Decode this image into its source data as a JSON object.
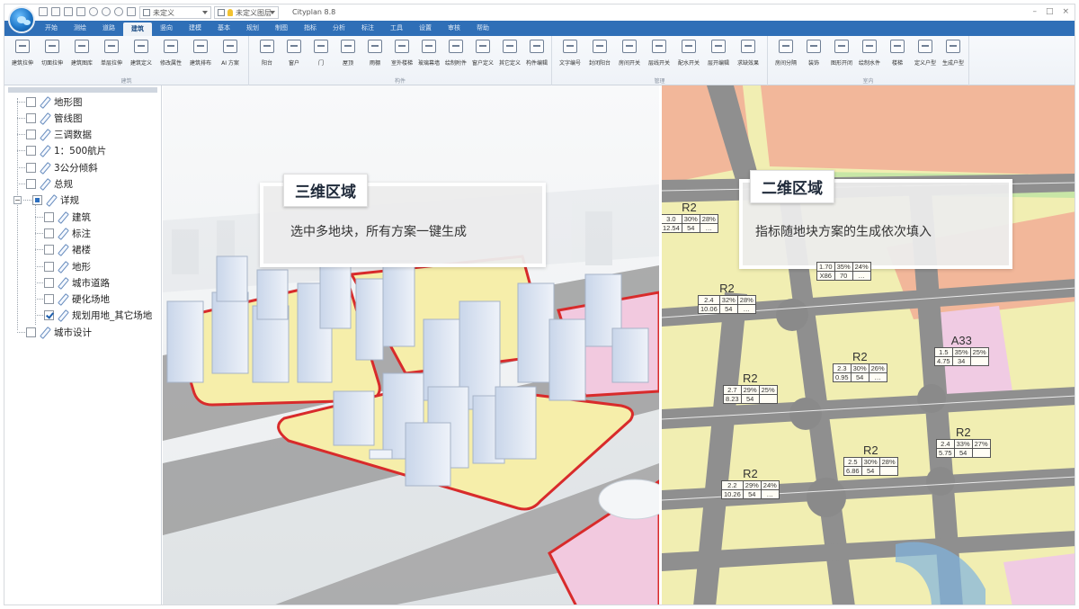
{
  "window": {
    "title": "Cityplan 8.8",
    "controls": [
      "–",
      "□",
      "×"
    ]
  },
  "quick_access": {
    "combo1": "未定义",
    "combo2": "未定义图层"
  },
  "ribbon": {
    "tabs": [
      "开始",
      "测绘",
      "道路",
      "建筑",
      "竖向",
      "建模",
      "基本",
      "规划",
      "制图",
      "指标",
      "分析",
      "标注",
      "工具",
      "设置",
      "审核",
      "帮助"
    ],
    "active_tab": "建筑",
    "groups": [
      {
        "title": "建筑",
        "buttons": [
          "建筑拉伸",
          "切面拉伸",
          "建筑图库",
          "单层拉伸",
          "建筑定义",
          "修改属性",
          "建筑排布",
          "AI 方案"
        ]
      },
      {
        "title": "构件",
        "buttons": [
          "阳台",
          "窗户",
          "门",
          "屋顶",
          "雨棚",
          "室外楼梯",
          "玻璃幕墙",
          "绘制附件",
          "窗户定义",
          "其它定义",
          "构件编辑"
        ]
      },
      {
        "title": "管理",
        "buttons": [
          "文字编号",
          "封闭阳台",
          "房间开关",
          "层线开关",
          "配水开关",
          "层开编辑",
          "求缺效果"
        ]
      },
      {
        "title": "室内",
        "buttons": [
          "房间分隔",
          "装饰",
          "图形开闭",
          "绘制水件",
          "楼梯",
          "定义户型",
          "生成户型"
        ]
      }
    ]
  },
  "tree": {
    "items": [
      {
        "label": "地形图",
        "state": "unchecked"
      },
      {
        "label": "管线图",
        "state": "unchecked"
      },
      {
        "label": "三调数据",
        "state": "unchecked"
      },
      {
        "label": "1：500航片",
        "state": "unchecked"
      },
      {
        "label": "3公分倾斜",
        "state": "unchecked"
      },
      {
        "label": "总规",
        "state": "unchecked"
      },
      {
        "label": "详规",
        "state": "partial"
      },
      {
        "label": "建筑",
        "state": "unchecked"
      },
      {
        "label": "标注",
        "state": "unchecked"
      },
      {
        "label": "裙楼",
        "state": "unchecked"
      },
      {
        "label": "地形",
        "state": "unchecked"
      },
      {
        "label": "城市道路",
        "state": "unchecked"
      },
      {
        "label": "硬化场地",
        "state": "unchecked"
      },
      {
        "label": "规划用地_其它场地",
        "state": "checked"
      },
      {
        "label": "城市设计",
        "state": "unchecked"
      }
    ]
  },
  "view3d": {
    "tag": "三维区域",
    "text": "选中多地块，所有方案一键生成"
  },
  "view2d": {
    "tag": "二维区域",
    "text": "指标随地块方案的生成依次填入",
    "parcels": [
      {
        "code": "R2",
        "far": "3.0",
        "density": "30%",
        "green": "28%",
        "height": "12.54",
        "floors": "54",
        "extra": "…"
      },
      {
        "code": "",
        "far": "1.70",
        "density": "35%",
        "green": "24%",
        "height": "X86",
        "floors": "70",
        "extra": "…"
      },
      {
        "code": "R2",
        "far": "2.4",
        "density": "32%",
        "green": "28%",
        "height": "10.06",
        "floors": "54",
        "extra": "…"
      },
      {
        "code": "A33",
        "far": "1.5",
        "density": "35%",
        "green": "25%",
        "height": "4.75",
        "floors": "34",
        "extra": ""
      },
      {
        "code": "R2",
        "far": "2.3",
        "density": "30%",
        "green": "26%",
        "height": "0.95",
        "floors": "54",
        "extra": "…"
      },
      {
        "code": "R2",
        "far": "2.7",
        "density": "29%",
        "green": "25%",
        "height": "8.23",
        "floors": "54",
        "extra": ""
      },
      {
        "code": "R2",
        "far": "2.4",
        "density": "33%",
        "green": "27%",
        "height": "5.75",
        "floors": "54",
        "extra": ""
      },
      {
        "code": "R2",
        "far": "2.5",
        "density": "30%",
        "green": "28%",
        "height": "6.86",
        "floors": "54",
        "extra": ""
      },
      {
        "code": "R2",
        "far": "2.2",
        "density": "29%",
        "green": "24%",
        "height": "10.26",
        "floors": "54",
        "extra": "…"
      }
    ]
  },
  "colors": {
    "ribbon_blue": "#2f6fb7",
    "residential": "#f1eeb2",
    "public": "#f0cbe3",
    "commercial": "#f2b79a",
    "road": "#8f8f8f",
    "parcel_outline": "#d82b2b"
  }
}
